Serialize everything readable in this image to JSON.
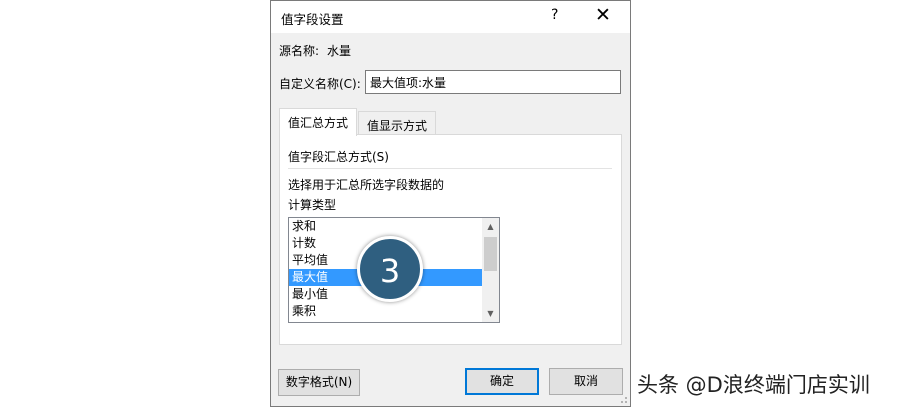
{
  "dialog": {
    "title": "值字段设置",
    "help_symbol": "?",
    "close_symbol": "✕",
    "source_label": "源名称:",
    "source_value": "水量",
    "custom_name_label": "自定义名称(C):",
    "custom_name_value": "最大值项:水量",
    "tabs": [
      {
        "label": "值汇总方式",
        "active": true
      },
      {
        "label": "值显示方式",
        "active": false
      }
    ],
    "section_title": "值字段汇总方式(S)",
    "description_line1": "选择用于汇总所选字段数据的",
    "description_line2": "计算类型",
    "list_items": [
      "求和",
      "计数",
      "平均值",
      "最大值",
      "最小值",
      "乘积"
    ],
    "selected_item": "最大值",
    "buttons": {
      "number_format": "数字格式(N)",
      "ok": "确定",
      "cancel": "取消"
    }
  },
  "step_badge": "3",
  "watermark": "头条 @D浪终端门店实训",
  "colors": {
    "selection": "#3399ff",
    "badge": "#2f5f80",
    "primary_border": "#0078d7"
  }
}
